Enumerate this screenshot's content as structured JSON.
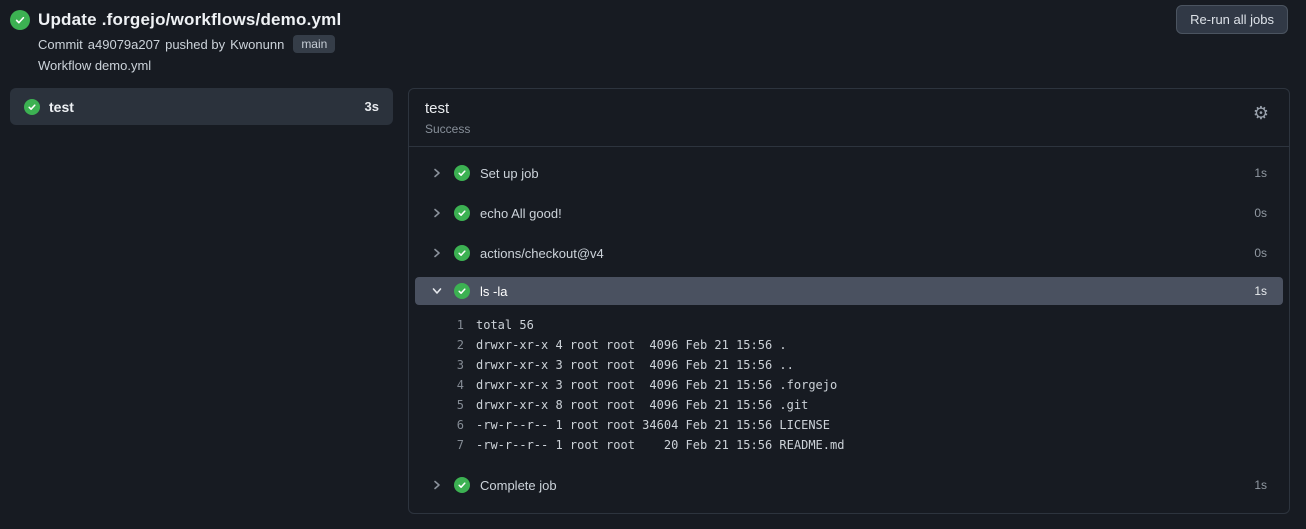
{
  "page": {
    "background": "#171b22",
    "success_green": "#3cb152"
  },
  "header": {
    "title": "Update .forgejo/workflows/demo.yml",
    "commit_prefix": "Commit",
    "commit_sha": "a49079a207",
    "commit_middle": "pushed by",
    "commit_author": "Kwonunn",
    "branch_badge": "main",
    "workflow_line": "Workflow demo.yml",
    "rerun_button": "Re-run all jobs"
  },
  "sidebar": {
    "jobs": [
      {
        "name": "test",
        "duration": "3s",
        "status": "success",
        "selected": true
      }
    ]
  },
  "main": {
    "job_title": "test",
    "job_status": "Success",
    "gear_icon": "⚙",
    "steps": [
      {
        "label": "Set up job",
        "duration": "1s",
        "expanded": false,
        "status": "success"
      },
      {
        "label": "echo All good!",
        "duration": "0s",
        "expanded": false,
        "status": "success"
      },
      {
        "label": "actions/checkout@v4",
        "duration": "0s",
        "expanded": false,
        "status": "success"
      },
      {
        "label": "ls -la",
        "duration": "1s",
        "expanded": true,
        "status": "success"
      },
      {
        "label": "Complete job",
        "duration": "1s",
        "expanded": false,
        "status": "success"
      }
    ],
    "log": {
      "lines": [
        {
          "num": "1",
          "text": "total 56"
        },
        {
          "num": "2",
          "text": "drwxr-xr-x 4 root root  4096 Feb 21 15:56 ."
        },
        {
          "num": "3",
          "text": "drwxr-xr-x 3 root root  4096 Feb 21 15:56 .."
        },
        {
          "num": "4",
          "text": "drwxr-xr-x 3 root root  4096 Feb 21 15:56 .forgejo"
        },
        {
          "num": "5",
          "text": "drwxr-xr-x 8 root root  4096 Feb 21 15:56 .git"
        },
        {
          "num": "6",
          "text": "-rw-r--r-- 1 root root 34604 Feb 21 15:56 LICENSE"
        },
        {
          "num": "7",
          "text": "-rw-r--r-- 1 root root    20 Feb 21 15:56 README.md"
        }
      ]
    }
  }
}
